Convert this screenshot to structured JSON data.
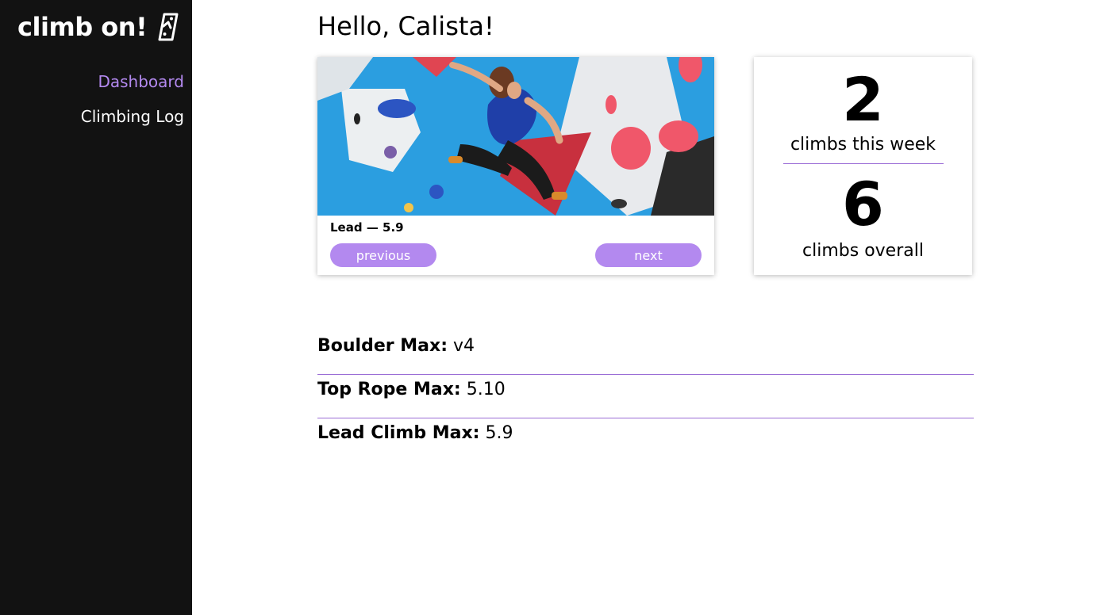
{
  "brand": {
    "name": "climb on!",
    "icon": "climbing-hold-icon"
  },
  "nav": {
    "items": [
      {
        "label": "Dashboard",
        "active": true
      },
      {
        "label": "Climbing Log",
        "active": false
      }
    ]
  },
  "greeting": "Hello, Calista!",
  "carousel": {
    "caption": "Lead — 5.9",
    "previous_label": "previous",
    "next_label": "next"
  },
  "stats": {
    "week_count": "2",
    "week_label": "climbs this week",
    "overall_count": "6",
    "overall_label": "climbs overall"
  },
  "max_grades": [
    {
      "label": "Boulder Max:",
      "value": "v4"
    },
    {
      "label": "Top Rope Max:",
      "value": "5.10"
    },
    {
      "label": "Lead Climb Max:",
      "value": "5.9"
    }
  ],
  "colors": {
    "accent": "#b389ef",
    "sidebar_bg": "#121212",
    "divider": "#9b6dd6"
  }
}
